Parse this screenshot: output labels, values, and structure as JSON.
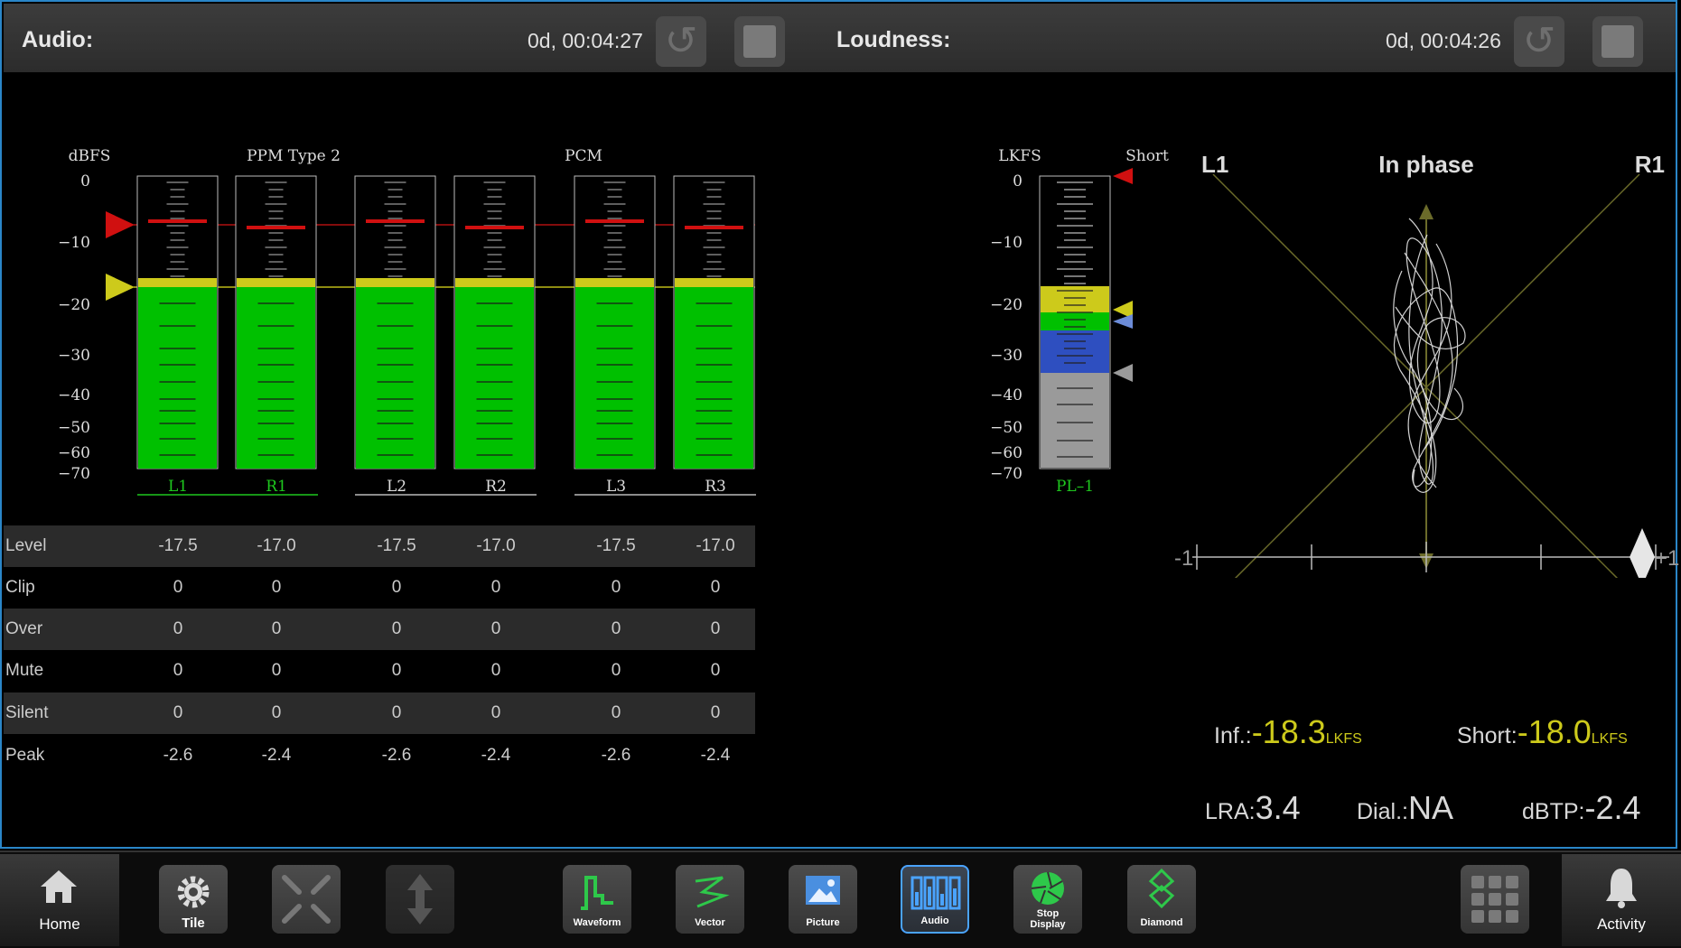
{
  "audio_header": {
    "label": "Audio:",
    "time": "0d, 00:04:27"
  },
  "loudness_header": {
    "label": "Loudness:",
    "time": "0d, 00:04:26"
  },
  "meter": {
    "scale_label": "dBFS",
    "ballistics": "PPM Type 2",
    "format": "PCM",
    "ticks": [
      "0",
      "−10",
      "−20",
      "−30",
      "−40",
      "−50",
      "−60",
      "−70"
    ],
    "channels": [
      "L1",
      "R1",
      "L2",
      "R2",
      "L3",
      "R3"
    ]
  },
  "table": {
    "rows": [
      {
        "label": "Level",
        "values": [
          "-17.5",
          "-17.0",
          "-17.5",
          "-17.0",
          "-17.5",
          "-17.0"
        ]
      },
      {
        "label": "Clip",
        "values": [
          "0",
          "0",
          "0",
          "0",
          "0",
          "0"
        ]
      },
      {
        "label": "Over",
        "values": [
          "0",
          "0",
          "0",
          "0",
          "0",
          "0"
        ]
      },
      {
        "label": "Mute",
        "values": [
          "0",
          "0",
          "0",
          "0",
          "0",
          "0"
        ]
      },
      {
        "label": "Silent",
        "values": [
          "0",
          "0",
          "0",
          "0",
          "0",
          "0"
        ]
      },
      {
        "label": "Peak",
        "values": [
          "-2.6",
          "-2.4",
          "-2.6",
          "-2.4",
          "-2.6",
          "-2.4"
        ]
      }
    ]
  },
  "loudness_meter": {
    "scale_label": "LKFS",
    "mode": "Short",
    "ticks": [
      "0",
      "−10",
      "−20",
      "−30",
      "−40",
      "−50",
      "−60",
      "−70"
    ],
    "channel": "PL–1"
  },
  "phase": {
    "left": "L1",
    "right": "R1",
    "status": "In phase",
    "min": "-1",
    "max": "+1"
  },
  "readouts": {
    "inf_label": "Inf.:",
    "inf_value": "-18.3",
    "inf_unit": "LKFS",
    "short_label": "Short:",
    "short_value": "-18.0",
    "short_unit": "LKFS",
    "lra_label": "LRA:",
    "lra_value": "3.4",
    "dial_label": "Dial.:",
    "dial_value": "NA",
    "dbtp_label": "dBTP:",
    "dbtp_value": "-2.4"
  },
  "dock": {
    "home": "Home",
    "tile": "Tile",
    "waveform": "Waveform",
    "vector": "Vector",
    "picture": "Picture",
    "audio": "Audio",
    "stop_display_1": "Stop",
    "stop_display_2": "Display",
    "diamond": "Diamond",
    "activity": "Activity"
  },
  "colors": {
    "accent": "#2a86c8",
    "green": "#00c000",
    "yellow": "#cdca1b",
    "red": "#d01010",
    "blue": "#2e4fc0"
  }
}
